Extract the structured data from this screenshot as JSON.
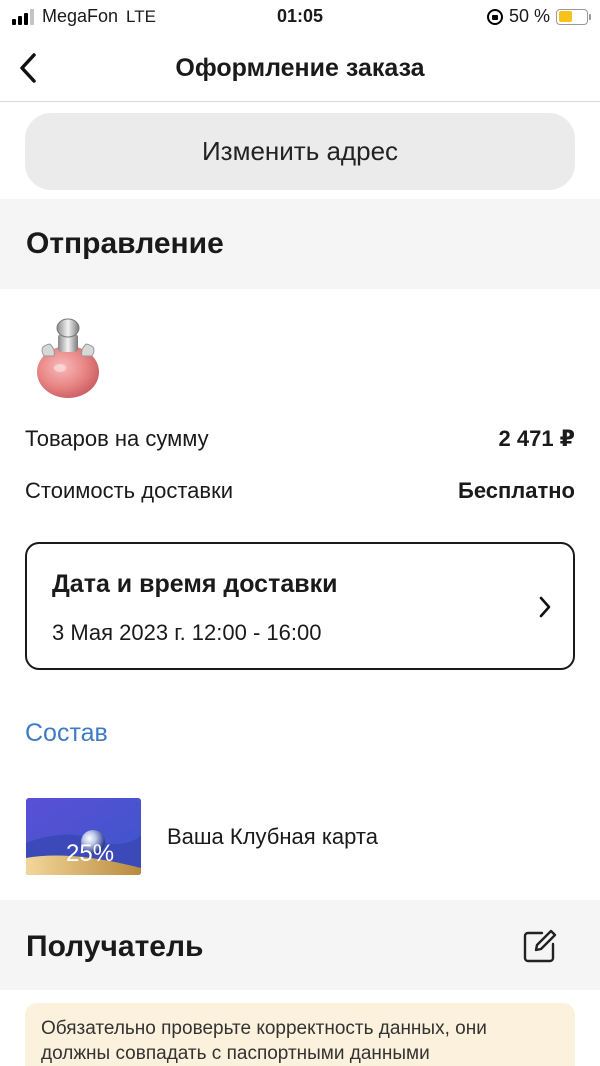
{
  "status_bar": {
    "carrier": "MegaFon",
    "network": "LTE",
    "time": "01:05",
    "battery_text": "50 %",
    "battery_level": 0.5,
    "signal_bars": 3
  },
  "nav": {
    "title": "Оформление заказа"
  },
  "change_address_label": "Изменить адрес",
  "shipment": {
    "title": "Отправление",
    "goods_label": "Товаров на сумму",
    "goods_value": "2 471 ₽",
    "delivery_cost_label": "Стоимость доставки",
    "delivery_cost_value": "Бесплатно",
    "delivery_card": {
      "title": "Дата и время доставки",
      "date": "3 Мая 2023 г. 12:00 - 16:00"
    },
    "composition_link": "Состав",
    "club_card": {
      "label": "Ваша Клубная карта",
      "discount": "25%"
    }
  },
  "recipient": {
    "title": "Получатель",
    "warning": "Обязательно проверьте корректность данных, они должны совпадать с паспортными данными"
  },
  "colors": {
    "accent_link": "#3e7bc4",
    "battery": "#f7c31a",
    "warning_bg": "#fcf1dc"
  }
}
